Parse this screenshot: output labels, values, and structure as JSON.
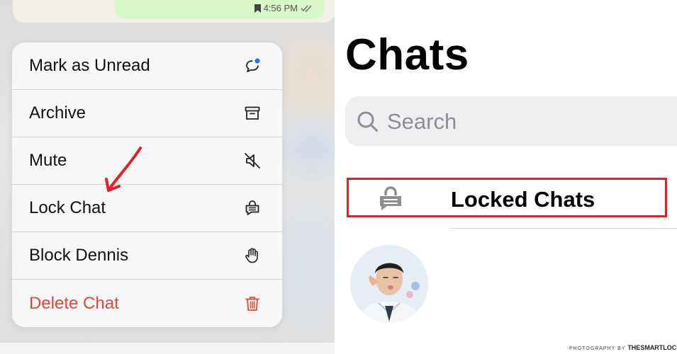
{
  "bubble": {
    "time": "4:56 PM"
  },
  "menu": {
    "items": [
      {
        "label": "Mark as Unread",
        "icon": "mark-unread-icon"
      },
      {
        "label": "Archive",
        "icon": "archive-icon"
      },
      {
        "label": "Mute",
        "icon": "mute-icon"
      },
      {
        "label": "Lock Chat",
        "icon": "lock-chat-icon"
      },
      {
        "label": "Block Dennis",
        "icon": "hand-icon"
      },
      {
        "label": "Delete Chat",
        "icon": "trash-icon"
      }
    ]
  },
  "chats": {
    "title": "Chats",
    "search_placeholder": "Search",
    "locked_label": "Locked Chats"
  },
  "credit": {
    "prefix": "PHOTOGRAPHY BY",
    "brand": "THESMARTLOCAL"
  },
  "colors": {
    "danger": "#e5473c",
    "highlight_box": "#e0202a",
    "accent_dot": "#1a7cf5"
  }
}
